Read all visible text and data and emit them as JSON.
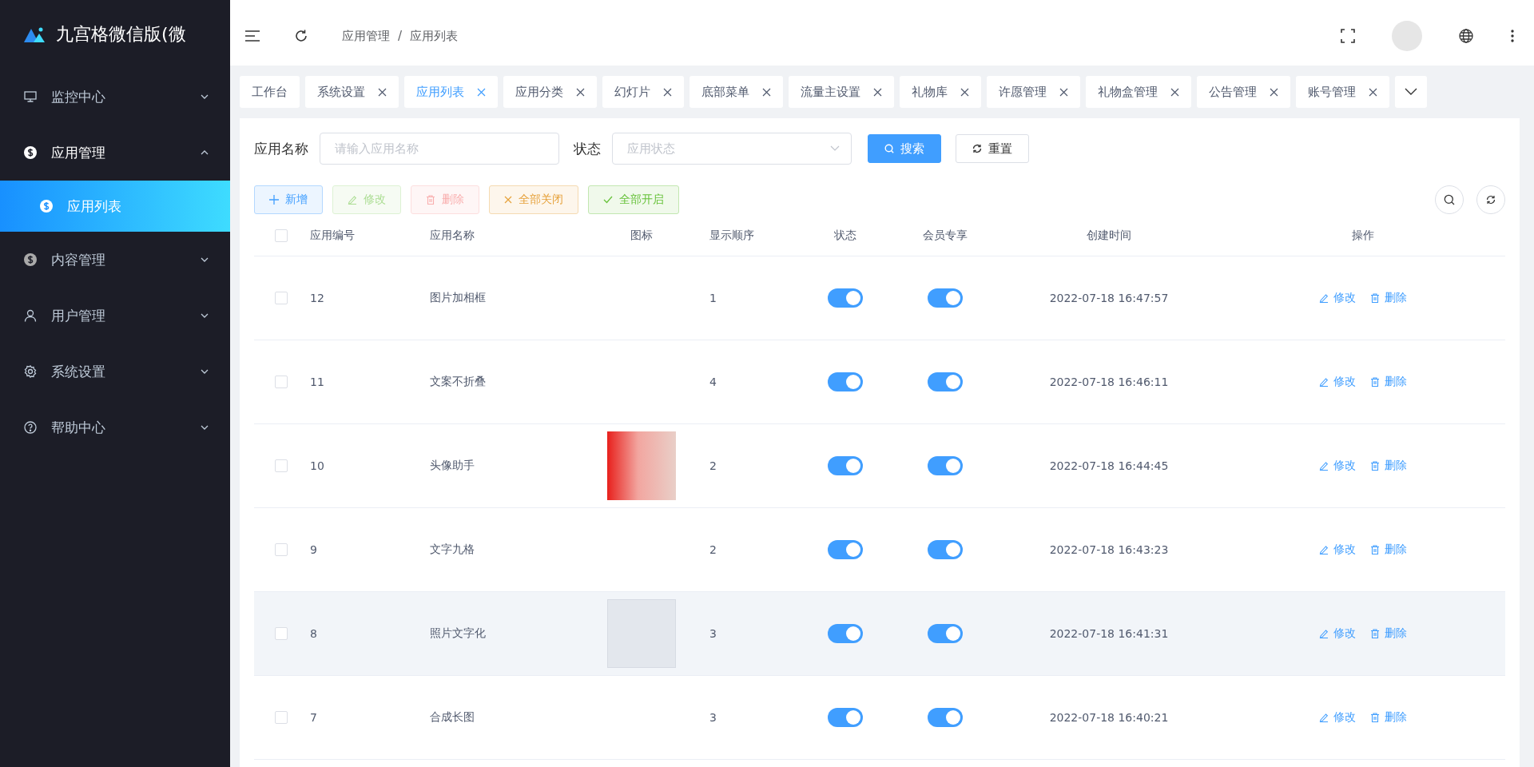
{
  "sidebar": {
    "logo_text": "九宫格微信版(微",
    "menu": [
      {
        "label": "监控中心",
        "expanded": false,
        "selected": false
      },
      {
        "label": "应用管理",
        "expanded": true,
        "selected": false,
        "children": [
          {
            "label": "应用列表",
            "selected": true
          }
        ]
      },
      {
        "label": "内容管理",
        "expanded": false,
        "selected": false
      },
      {
        "label": "用户管理",
        "expanded": false,
        "selected": false
      },
      {
        "label": "系统设置",
        "expanded": false,
        "selected": false
      },
      {
        "label": "帮助中心",
        "expanded": false,
        "selected": false
      }
    ]
  },
  "header": {
    "breadcrumb": [
      "应用管理",
      "应用列表"
    ],
    "separator": "/"
  },
  "tabs": [
    {
      "label": "工作台",
      "selected": false,
      "closable": false
    },
    {
      "label": "系统设置",
      "selected": false,
      "closable": true
    },
    {
      "label": "应用列表",
      "selected": true,
      "closable": true
    },
    {
      "label": "应用分类",
      "selected": false,
      "closable": true
    },
    {
      "label": "幻灯片",
      "selected": false,
      "closable": true
    },
    {
      "label": "底部菜单",
      "selected": false,
      "closable": true
    },
    {
      "label": "流量主设置",
      "selected": false,
      "closable": true
    },
    {
      "label": "礼物库",
      "selected": false,
      "closable": true
    },
    {
      "label": "许愿管理",
      "selected": false,
      "closable": true
    },
    {
      "label": "礼物盒管理",
      "selected": false,
      "closable": true
    },
    {
      "label": "公告管理",
      "selected": false,
      "closable": true
    },
    {
      "label": "账号管理",
      "selected": false,
      "closable": true
    }
  ],
  "filters": {
    "name_label": "应用名称",
    "name_placeholder": "请输入应用名称",
    "status_label": "状态",
    "status_placeholder": "应用状态",
    "search_button": "搜索",
    "reset_button": "重置"
  },
  "actions": [
    {
      "label": "新增",
      "kind": "add",
      "disabled": false
    },
    {
      "label": "修改",
      "kind": "edit",
      "disabled": true
    },
    {
      "label": "删除",
      "kind": "delete",
      "disabled": true
    },
    {
      "label": "全部关闭",
      "kind": "close",
      "disabled": false
    },
    {
      "label": "全部开启",
      "kind": "open",
      "disabled": false
    }
  ],
  "table": {
    "select_all_checked": false,
    "columns": [
      "应用编号",
      "应用名称",
      "图标",
      "显示顺序",
      "状态",
      "会员专享",
      "创建时间",
      "操作"
    ],
    "rows": [
      {
        "checked": false,
        "highlighted": false,
        "id": "12",
        "name": "图片加相框",
        "picture": false,
        "order": "1",
        "status_on": true,
        "vip_on": true,
        "created": "2022-07-18 16:47:57",
        "edit": "修改",
        "delete": "删除"
      },
      {
        "checked": false,
        "highlighted": false,
        "id": "11",
        "name": "文案不折叠",
        "picture": false,
        "order": "4",
        "status_on": true,
        "vip_on": true,
        "created": "2022-07-18 16:46:11",
        "edit": "修改",
        "delete": "删除"
      },
      {
        "checked": false,
        "highlighted": false,
        "id": "10",
        "name": "头像助手",
        "picture": true,
        "faded": false,
        "order": "2",
        "status_on": true,
        "vip_on": true,
        "created": "2022-07-18 16:44:45",
        "edit": "修改",
        "delete": "删除"
      },
      {
        "checked": false,
        "highlighted": false,
        "id": "9",
        "name": "文字九格",
        "picture": false,
        "order": "2",
        "status_on": true,
        "vip_on": true,
        "created": "2022-07-18 16:43:23",
        "edit": "修改",
        "delete": "删除"
      },
      {
        "checked": false,
        "highlighted": true,
        "id": "8",
        "name": "照片文字化",
        "picture": true,
        "faded": true,
        "order": "3",
        "status_on": true,
        "vip_on": true,
        "created": "2022-07-18 16:41:31",
        "edit": "修改",
        "delete": "删除"
      },
      {
        "checked": false,
        "highlighted": false,
        "id": "7",
        "name": "合成长图",
        "picture": false,
        "order": "3",
        "status_on": true,
        "vip_on": true,
        "created": "2022-07-18 16:40:21",
        "edit": "修改",
        "delete": "删除"
      }
    ]
  }
}
